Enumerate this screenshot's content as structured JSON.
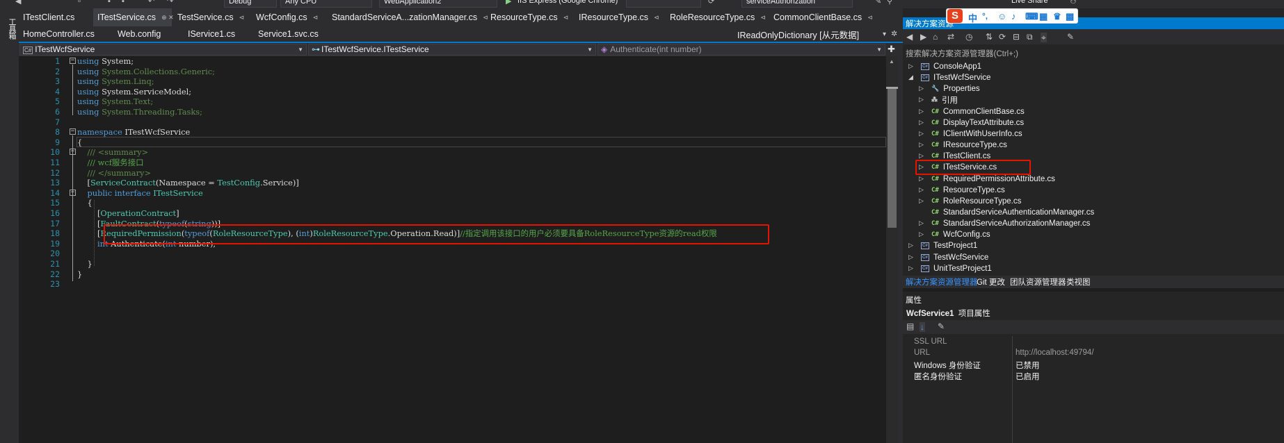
{
  "toolbar": {
    "config": "Debug",
    "platform": "Any CPU",
    "startup_project": "WebApplication2",
    "run_target": "IIS Express (Google Chrome)",
    "search_combo": "serviceAuthorization",
    "live_share": "Live Share"
  },
  "left_strip": {
    "label": "工具箱"
  },
  "tabs_row1": [
    {
      "label": "ITestClient.cs"
    },
    {
      "label": "ITestService.cs"
    },
    {
      "label": "TestService.cs"
    },
    {
      "label": "WcfConfig.cs"
    },
    {
      "label": "StandardServiceA...zationManager.cs"
    },
    {
      "label": "ResourceType.cs"
    },
    {
      "label": "IResourceType.cs"
    },
    {
      "label": "RoleResourceType.cs"
    },
    {
      "label": "CommonClientBase.cs"
    }
  ],
  "tabs_row2": [
    {
      "label": "HomeController.cs"
    },
    {
      "label": "Web.config"
    },
    {
      "label": "IService1.cs"
    },
    {
      "label": "Service1.svc.cs"
    },
    {
      "label": "IReadOnlyDictionary [从元数据]"
    }
  ],
  "navbar": {
    "project": "ITestWcfService",
    "type": "ITestWcfService.ITestService",
    "member": "Authenticate(int number)"
  },
  "code_lines": [
    {
      "n": "1",
      "segments": [
        {
          "t": "using",
          "c": "kw"
        },
        {
          "t": " System;",
          "c": ""
        }
      ]
    },
    {
      "n": "2",
      "segments": [
        {
          "t": "using",
          "c": "kw"
        },
        {
          "t": " System.Collections.Generic;",
          "c": "cmg"
        }
      ]
    },
    {
      "n": "3",
      "segments": [
        {
          "t": "using",
          "c": "kw"
        },
        {
          "t": " System.Linq;",
          "c": "cmg"
        }
      ]
    },
    {
      "n": "4",
      "segments": [
        {
          "t": "using",
          "c": "kw"
        },
        {
          "t": " System.ServiceModel;",
          "c": ""
        }
      ]
    },
    {
      "n": "5",
      "segments": [
        {
          "t": "using",
          "c": "kw"
        },
        {
          "t": " System.Text;",
          "c": "cmg"
        }
      ]
    },
    {
      "n": "6",
      "segments": [
        {
          "t": "using",
          "c": "kw"
        },
        {
          "t": " System.Threading.Tasks;",
          "c": "cmg"
        }
      ]
    },
    {
      "n": "7",
      "segments": []
    },
    {
      "n": "8",
      "segments": [
        {
          "t": "namespace",
          "c": "kw"
        },
        {
          "t": " ITestWcfService",
          "c": ""
        }
      ]
    },
    {
      "n": "9",
      "segments": [
        {
          "t": "{",
          "c": ""
        }
      ]
    },
    {
      "n": "10",
      "segments": [
        {
          "t": "    /// <summary>",
          "c": "cmg"
        }
      ]
    },
    {
      "n": "11",
      "segments": [
        {
          "t": "    /// wcf服务接口",
          "c": "cm"
        }
      ]
    },
    {
      "n": "12",
      "segments": [
        {
          "t": "    /// </summary>",
          "c": "cmg"
        }
      ]
    },
    {
      "n": "13",
      "segments": [
        {
          "t": "    [",
          "c": ""
        },
        {
          "t": "ServiceContract",
          "c": "ty"
        },
        {
          "t": "(Namespace = ",
          "c": ""
        },
        {
          "t": "TestConfig",
          "c": "ty"
        },
        {
          "t": ".Service)]",
          "c": ""
        }
      ]
    },
    {
      "n": "14",
      "segments": [
        {
          "t": "    ",
          "c": ""
        },
        {
          "t": "public",
          "c": "kw"
        },
        {
          "t": " ",
          "c": ""
        },
        {
          "t": "interface",
          "c": "kw"
        },
        {
          "t": " ",
          "c": ""
        },
        {
          "t": "ITestService",
          "c": "ty"
        }
      ]
    },
    {
      "n": "15",
      "segments": [
        {
          "t": "    {",
          "c": ""
        }
      ]
    },
    {
      "n": "16",
      "segments": [
        {
          "t": "        [",
          "c": ""
        },
        {
          "t": "OperationContract",
          "c": "ty"
        },
        {
          "t": "]",
          "c": ""
        }
      ]
    },
    {
      "n": "17",
      "segments": [
        {
          "t": "        [",
          "c": ""
        },
        {
          "t": "FaultContract",
          "c": "ty"
        },
        {
          "t": "(",
          "c": ""
        },
        {
          "t": "typeof",
          "c": "kw"
        },
        {
          "t": "(",
          "c": ""
        },
        {
          "t": "string",
          "c": "kw"
        },
        {
          "t": "))]",
          "c": ""
        }
      ]
    },
    {
      "n": "18",
      "segments": [
        {
          "t": "        [",
          "c": ""
        },
        {
          "t": "RequiredPermission",
          "c": "ty"
        },
        {
          "t": "(",
          "c": ""
        },
        {
          "t": "typeof",
          "c": "kw"
        },
        {
          "t": "(",
          "c": ""
        },
        {
          "t": "RoleResourceType",
          "c": "ty"
        },
        {
          "t": "), (",
          "c": ""
        },
        {
          "t": "int",
          "c": "kw"
        },
        {
          "t": ")",
          "c": ""
        },
        {
          "t": "RoleResourceType",
          "c": "ty"
        },
        {
          "t": ".Operation.Read)]",
          "c": ""
        },
        {
          "t": "//指定调用该接口的用户必须要具备RoleResourceType资源的read权限",
          "c": "cm"
        }
      ]
    },
    {
      "n": "19",
      "segments": [
        {
          "t": "        ",
          "c": ""
        },
        {
          "t": "int",
          "c": "kw"
        },
        {
          "t": " Authenticate(",
          "c": ""
        },
        {
          "t": "int",
          "c": "kw"
        },
        {
          "t": " number);",
          "c": ""
        }
      ]
    },
    {
      "n": "20",
      "segments": []
    },
    {
      "n": "21",
      "segments": [
        {
          "t": "    }",
          "c": ""
        }
      ]
    },
    {
      "n": "22",
      "segments": [
        {
          "t": "}",
          "c": ""
        }
      ]
    },
    {
      "n": "23",
      "segments": []
    }
  ],
  "solution_explorer": {
    "title": "解决方案资源",
    "search_placeholder": "搜索解决方案资源管理器(Ctrl+;)",
    "items": [
      {
        "label": "ConsoleApp1",
        "kind": "project",
        "depth": 0,
        "expander": "▷"
      },
      {
        "label": "ITestWcfService",
        "kind": "project",
        "depth": 0,
        "expander": "◢"
      },
      {
        "label": "Properties",
        "kind": "wrench",
        "depth": 1,
        "expander": "▷"
      },
      {
        "label": "引用",
        "kind": "refs",
        "depth": 1,
        "expander": "▷"
      },
      {
        "label": "CommonClientBase.cs",
        "kind": "cs",
        "depth": 1,
        "expander": "▷"
      },
      {
        "label": "DisplayTextAttribute.cs",
        "kind": "cs",
        "depth": 1,
        "expander": "▷"
      },
      {
        "label": "IClientWithUserInfo.cs",
        "kind": "cs",
        "depth": 1,
        "expander": "▷"
      },
      {
        "label": "IResourceType.cs",
        "kind": "cs",
        "depth": 1,
        "expander": "▷"
      },
      {
        "label": "ITestClient.cs",
        "kind": "cs",
        "depth": 1,
        "expander": "▷"
      },
      {
        "label": "ITestService.cs",
        "kind": "cs",
        "depth": 1,
        "expander": "▷"
      },
      {
        "label": "RequiredPermissionAttribute.cs",
        "kind": "cs",
        "depth": 1,
        "expander": "▷"
      },
      {
        "label": "ResourceType.cs",
        "kind": "cs",
        "depth": 1,
        "expander": "▷"
      },
      {
        "label": "RoleResourceType.cs",
        "kind": "cs",
        "depth": 1,
        "expander": "▷"
      },
      {
        "label": "StandardServiceAuthenticationManager.cs",
        "kind": "cs",
        "depth": 1,
        "expander": ""
      },
      {
        "label": "StandardServiceAuthorizationManager.cs",
        "kind": "cs",
        "depth": 1,
        "expander": "▷"
      },
      {
        "label": "WcfConfig.cs",
        "kind": "cs",
        "depth": 1,
        "expander": "▷"
      },
      {
        "label": "TestProject1",
        "kind": "project",
        "depth": 0,
        "expander": "▷"
      },
      {
        "label": "TestWcfService",
        "kind": "project",
        "depth": 0,
        "expander": "▷"
      },
      {
        "label": "UnitTestProject1",
        "kind": "project",
        "depth": 0,
        "expander": "▷"
      }
    ],
    "bottom_tabs": [
      "解决方案资源管理器",
      "Git 更改",
      "团队资源管理器",
      "类视图"
    ]
  },
  "properties": {
    "title": "属性",
    "object_name": "WcfService1",
    "object_kind": "项目属性",
    "rows": [
      {
        "name": "SSL URL",
        "value": "",
        "dim": true
      },
      {
        "name": "URL",
        "value": "http://localhost:49794/",
        "dim": true
      },
      {
        "name": "Windows 身份验证",
        "value": "已禁用",
        "dim": false
      },
      {
        "name": "匿名身份验证",
        "value": "已启用",
        "dim": false
      }
    ]
  },
  "ime": {
    "logo": "S",
    "mode": "中"
  },
  "colors": {
    "accent": "#007acc",
    "highlight_box": "#e51400",
    "editor_bg": "#1e1e1e"
  }
}
